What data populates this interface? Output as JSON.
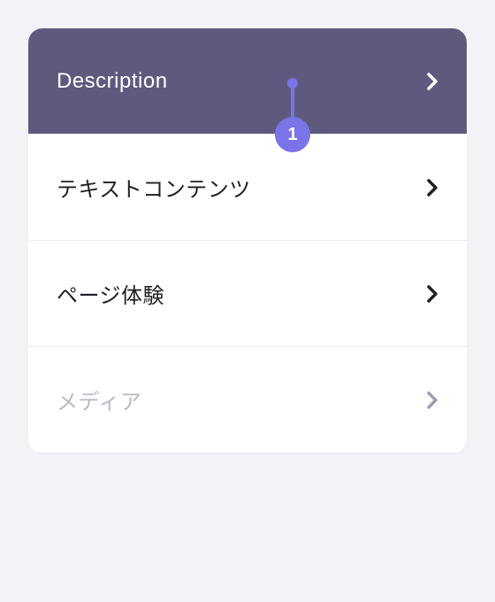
{
  "panel": {
    "items": [
      {
        "label": "Description",
        "state": "active"
      },
      {
        "label": "テキストコンテンツ",
        "state": "normal"
      },
      {
        "label": "ページ体験",
        "state": "normal"
      },
      {
        "label": "メディア",
        "state": "disabled"
      }
    ]
  },
  "marker": {
    "number": "1"
  },
  "colors": {
    "accent": "#7a74e8",
    "active_bg": "#5e5a7d",
    "page_bg": "#f2f3f7"
  }
}
